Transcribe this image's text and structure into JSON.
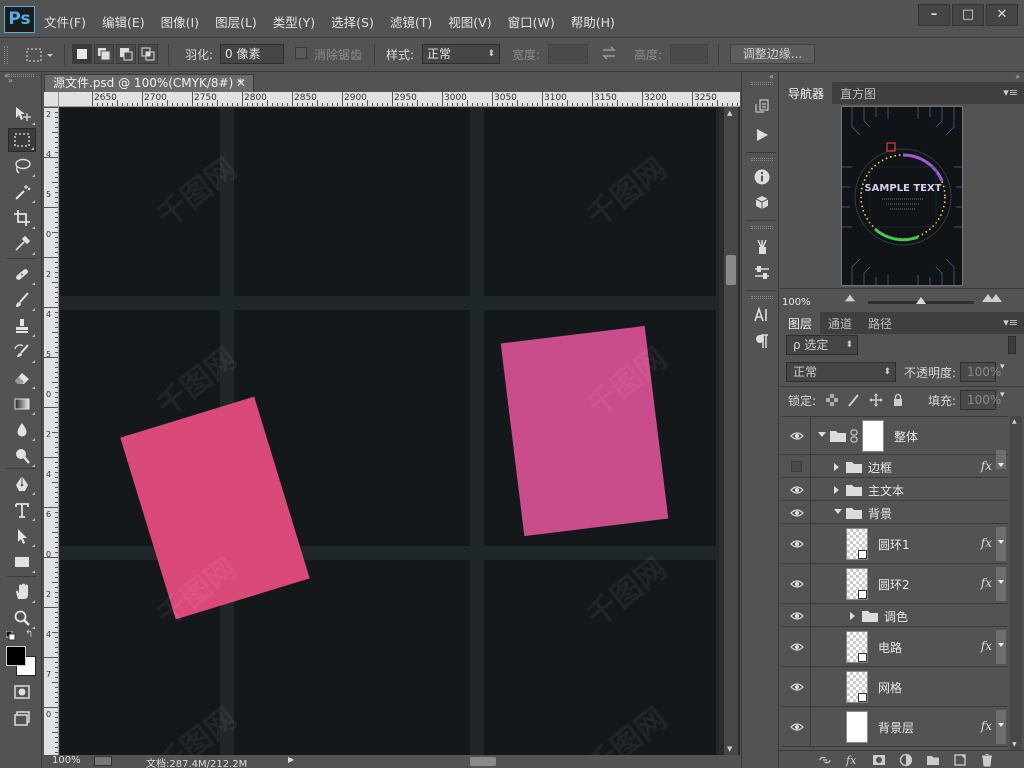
{
  "app": {
    "logo": "Ps",
    "menu": [
      "文件(F)",
      "编辑(E)",
      "图像(I)",
      "图层(L)",
      "类型(Y)",
      "选择(S)",
      "滤镜(T)",
      "视图(V)",
      "窗口(W)",
      "帮助(H)"
    ],
    "window_controls": [
      "–",
      "□",
      "✕"
    ]
  },
  "options": {
    "feather_label": "羽化:",
    "feather_value": "0 像素",
    "antialias_label": "消除锯齿",
    "style_label": "样式:",
    "style_value": "正常",
    "width_label": "宽度:",
    "height_label": "高度:",
    "refine_edge_label": "调整边缘..."
  },
  "tools": [
    {
      "name": "move-tool",
      "icon": "move-icon"
    },
    {
      "name": "marquee-tool",
      "icon": "rect-marquee-icon",
      "active": true
    },
    {
      "name": "lasso-tool",
      "icon": "lasso-icon"
    },
    {
      "name": "magic-wand-tool",
      "icon": "magic-wand-icon"
    },
    {
      "name": "crop-tool",
      "icon": "crop-icon"
    },
    {
      "name": "eyedropper-tool",
      "icon": "eyedropper-icon"
    },
    {
      "name": "healing-tool",
      "icon": "bandage-icon"
    },
    {
      "name": "brush-tool",
      "icon": "brush-icon"
    },
    {
      "name": "stamp-tool",
      "icon": "stamp-icon"
    },
    {
      "name": "history-brush-tool",
      "icon": "history-brush-icon"
    },
    {
      "name": "eraser-tool",
      "icon": "eraser-icon"
    },
    {
      "name": "gradient-tool",
      "icon": "gradient-icon"
    },
    {
      "name": "blur-tool",
      "icon": "droplet-icon"
    },
    {
      "name": "dodge-tool",
      "icon": "dodge-icon"
    },
    {
      "name": "pen-tool",
      "icon": "pen-icon"
    },
    {
      "name": "type-tool",
      "icon": "type-icon"
    },
    {
      "name": "path-selection-tool",
      "icon": "path-select-icon"
    },
    {
      "name": "shape-tool",
      "icon": "rectangle-shape-icon"
    },
    {
      "name": "hand-tool",
      "icon": "hand-icon"
    },
    {
      "name": "zoom-tool",
      "icon": "zoom-icon"
    }
  ],
  "document": {
    "tab_title": "源文件.psd @ 100%(CMYK/8#) *",
    "ruler_labels": [
      "2650",
      "2700",
      "2750",
      "2800",
      "2850",
      "2900",
      "2950",
      "3000",
      "3050",
      "3100",
      "3150",
      "3200",
      "3250"
    ],
    "vruler_labels": [
      "2",
      "4",
      "5",
      "0",
      "2",
      "4",
      "5",
      "0",
      "2",
      "4",
      "6",
      "0",
      "2",
      "4",
      "7",
      "0"
    ],
    "watermark_text": "千图网",
    "card_colors": {
      "left": "#d94a78",
      "right": "#c94d8a"
    }
  },
  "status": {
    "zoom": "100%",
    "doc_size": "文档:287.4M/212.2M"
  },
  "navigator": {
    "tabs": [
      "导航器",
      "直方图"
    ],
    "zoom": "100%",
    "thumb_text": "SAMPLE TEXT"
  },
  "layers": {
    "tabs": [
      "图层",
      "通道",
      "路径"
    ],
    "filter_label": "ρ 选定",
    "blend_mode": "正常",
    "opacity_label": "不透明度:",
    "opacity_value": "100%",
    "lock_label": "锁定:",
    "fill_label": "填充:",
    "fill_value": "100%",
    "rows": [
      {
        "name": "整体",
        "kind": "group-linked",
        "visible": true,
        "indent": 0,
        "expanded": true
      },
      {
        "name": "边框",
        "kind": "group",
        "visible": false,
        "indent": 1,
        "expanded": false,
        "fx": true
      },
      {
        "name": "主文本",
        "kind": "group",
        "visible": true,
        "indent": 1,
        "expanded": false
      },
      {
        "name": "背景",
        "kind": "group",
        "visible": true,
        "indent": 1,
        "expanded": true
      },
      {
        "name": "圆环1",
        "kind": "smart",
        "visible": true,
        "indent": 2,
        "fx": true
      },
      {
        "name": "圆环2",
        "kind": "smart",
        "visible": true,
        "indent": 2,
        "fx": true
      },
      {
        "name": "调色",
        "kind": "group",
        "visible": true,
        "indent": 2,
        "expanded": false
      },
      {
        "name": "电路",
        "kind": "smart",
        "visible": true,
        "indent": 2,
        "fx": true
      },
      {
        "name": "网格",
        "kind": "smart",
        "visible": true,
        "indent": 2
      },
      {
        "name": "背景层",
        "kind": "plain",
        "visible": true,
        "indent": 2,
        "fx": true
      }
    ],
    "footer_icons": [
      "link-icon",
      "fx-icon",
      "mask-icon",
      "adjustment-icon",
      "new-group-icon",
      "new-layer-icon",
      "trash-icon"
    ],
    "fx_label": "fx"
  }
}
